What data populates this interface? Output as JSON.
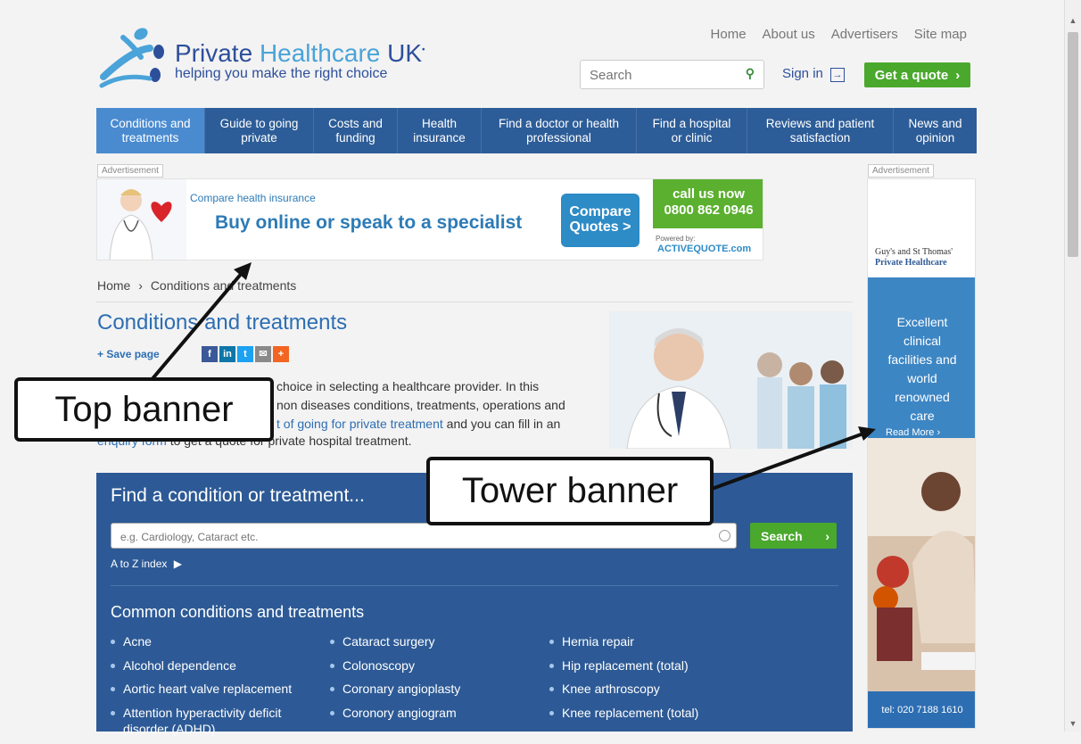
{
  "header": {
    "logo_title_dark": "Private",
    "logo_title_light": "Healthcare",
    "logo_title_uk": "UK",
    "logo_tagline": "helping you make the right choice",
    "top_links": [
      "Home",
      "About us",
      "Advertisers",
      "Site map"
    ],
    "search_placeholder": "Search",
    "signin_label": "Sign in",
    "quote_label": "Get a quote"
  },
  "nav": {
    "items": [
      "Conditions and treatments",
      "Guide to going private",
      "Costs and funding",
      "Health insurance",
      "Find a doctor or health professional",
      "Find a hospital or clinic",
      "Reviews and patient satisfaction",
      "News and opinion"
    ],
    "active_index": 0
  },
  "ads": {
    "label": "Advertisement",
    "top_banner": {
      "small_text": "Compare health insurance",
      "big_text": "Buy online or speak to a specialist",
      "compare_text": "Compare Quotes >",
      "call_text": "call us now",
      "phone": "0800 862 0946",
      "powered_by": "Powered by:",
      "brand": "ACTIVEQUOTE.com"
    },
    "tower_banner": {
      "heading_line1": "Guy's and St Thomas'",
      "heading_line2": "Private Healthcare",
      "body": "Excellent clinical facilities and world renowned care",
      "read_more": "Read More",
      "tel": "tel: 020 7188 1610"
    }
  },
  "breadcrumb": {
    "home": "Home",
    "separator": "›",
    "current": "Conditions and treatments"
  },
  "page": {
    "title": "Conditions and treatments",
    "save_page": "+ Save page",
    "intro_line1": "choice in selecting a healthcare provider. In this",
    "intro_line2": "non diseases conditions, treatments, operations and",
    "intro_link": "t of going for private treatment",
    "intro_line3_tail": " and you can fill in an",
    "intro_line4_link": "enquiry form",
    "intro_line4_tail": " to get a quote for private hospital treatment."
  },
  "finder": {
    "title": "Find a condition or treatment...",
    "placeholder": "e.g. Cardiology, Cataract etc.",
    "button": "Search",
    "atoz": "A to Z index",
    "common_title": "Common conditions and treatments",
    "col1": [
      "Acne",
      "Alcohol dependence",
      "Aortic heart valve replacement",
      "Attention hyperactivity deficit disorder (ADHD)"
    ],
    "col2": [
      "Cataract surgery",
      "Colonoscopy",
      "Coronary angioplasty",
      "Coronory angiogram"
    ],
    "col3": [
      "Hernia repair",
      "Hip replacement (total)",
      "Knee arthroscopy",
      "Knee replacement (total)"
    ]
  },
  "callouts": {
    "top": "Top banner",
    "tower": "Tower banner"
  },
  "colors": {
    "brand_blue": "#2d5a96",
    "nav_active": "#4a8bd0",
    "green": "#4aa82d"
  }
}
